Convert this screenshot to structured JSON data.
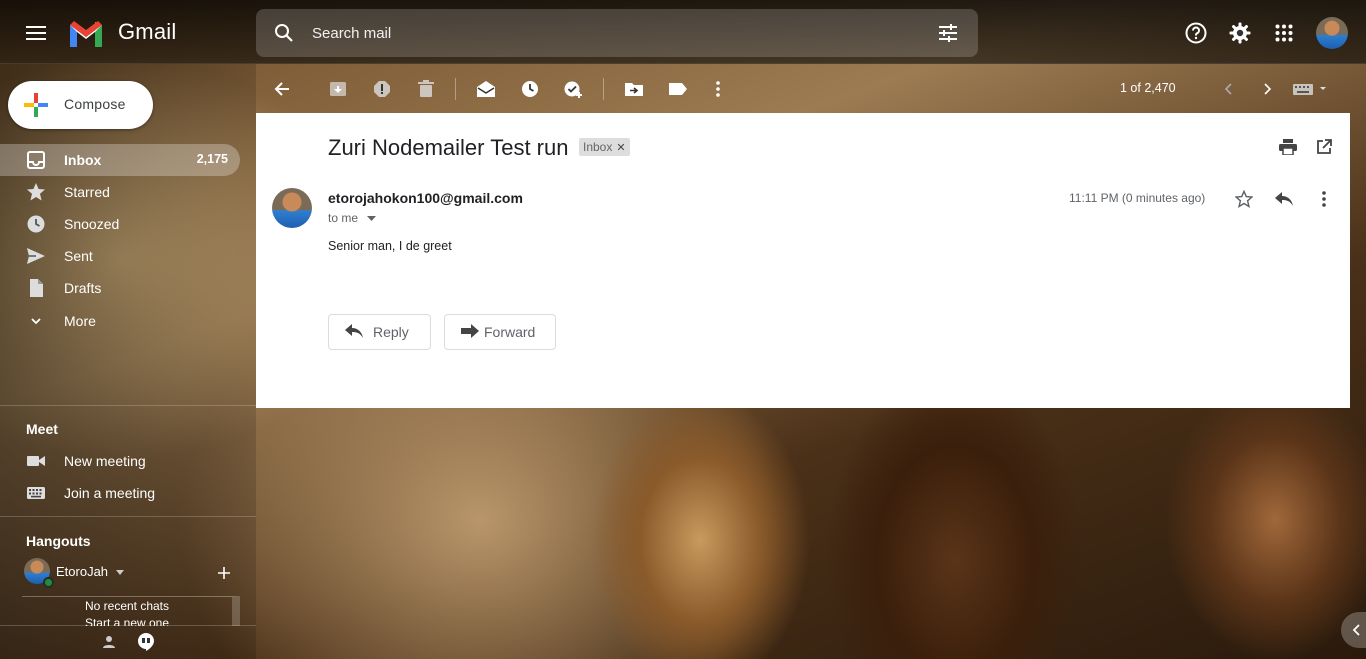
{
  "header": {
    "app_name": "Gmail",
    "search_placeholder": "Search mail"
  },
  "toolbar": {
    "pager": "1 of 2,470"
  },
  "sidebar": {
    "compose_label": "Compose",
    "items": [
      {
        "label": "Inbox",
        "count": "2,175",
        "icon": "inbox-icon",
        "active": true
      },
      {
        "label": "Starred",
        "icon": "star-icon"
      },
      {
        "label": "Snoozed",
        "icon": "clock-icon"
      },
      {
        "label": "Sent",
        "icon": "send-icon"
      },
      {
        "label": "Drafts",
        "icon": "draft-icon"
      },
      {
        "label": "More",
        "icon": "chevron-down-icon"
      }
    ],
    "meet": {
      "title": "Meet",
      "new_meeting": "New meeting",
      "join_meeting": "Join a meeting"
    },
    "hangouts": {
      "title": "Hangouts",
      "user": "EtoroJah",
      "no_chats": "No recent chats",
      "start_new": "Start a new one"
    }
  },
  "email": {
    "subject": "Zuri Nodemailer Test run",
    "label": "Inbox",
    "sender": "etorojahokon100@gmail.com",
    "to": "to me",
    "time": "11:11 PM (0 minutes ago)",
    "body": "Senior man, I de greet",
    "reply_label": "Reply",
    "forward_label": "Forward"
  },
  "colors": {
    "accent_red": "#EA4335",
    "accent_blue": "#4285F4",
    "accent_green": "#34A853",
    "accent_yellow": "#FBBC04",
    "online": "#1e8e3e"
  }
}
